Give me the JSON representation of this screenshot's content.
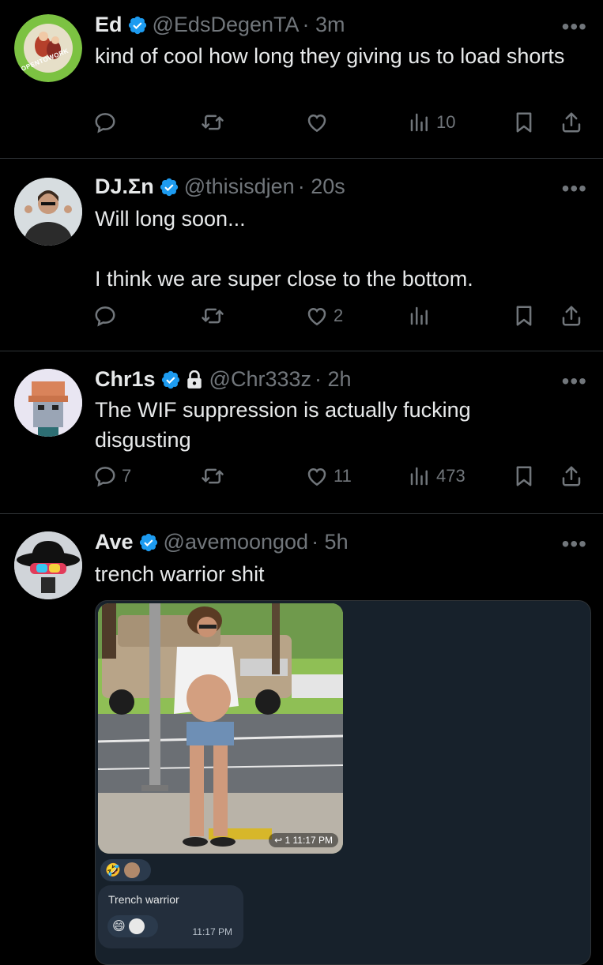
{
  "colors": {
    "accent": "#1d9bf0",
    "muted": "#71767b",
    "bg": "#000000",
    "chat_bg": "#17212b",
    "bubble": "#232e3c"
  },
  "tweets": [
    {
      "name": "Ed",
      "handle": "@EdsDegenTA",
      "time": "· 3m",
      "text": "kind of cool how long they giving us to load shorts",
      "reply_count": "",
      "retweet_count": "",
      "like_count": "",
      "views": "10",
      "avatar_badge": "#OPENTOWORK"
    },
    {
      "name": "DJ.Σn",
      "handle": "@thisisdjen",
      "time": "· 20s",
      "text_lines": [
        "Will long soon...",
        "",
        "I think we are super close to the bottom."
      ],
      "reply_count": "",
      "retweet_count": "",
      "like_count": "2",
      "views": ""
    },
    {
      "name": "Chr1s",
      "handle": "@Chr333z",
      "time": "· 2h",
      "text": "The WIF suppression is actually fucking disgusting",
      "reply_count": "7",
      "retweet_count": "",
      "like_count": "11",
      "views": "473"
    },
    {
      "name": "Ave",
      "handle": "@avemoongod",
      "time": "· 5h",
      "text": "trench warrior shit"
    }
  ],
  "media": {
    "photo_time": "11:17 PM",
    "photo_reply_icon": "↩",
    "photo_count": "1",
    "reaction_emoji": "🤣",
    "message_text": "Trench warrior",
    "message_time": "11:17 PM",
    "message_emoji": "😄"
  },
  "icons": {
    "more": "•••"
  }
}
